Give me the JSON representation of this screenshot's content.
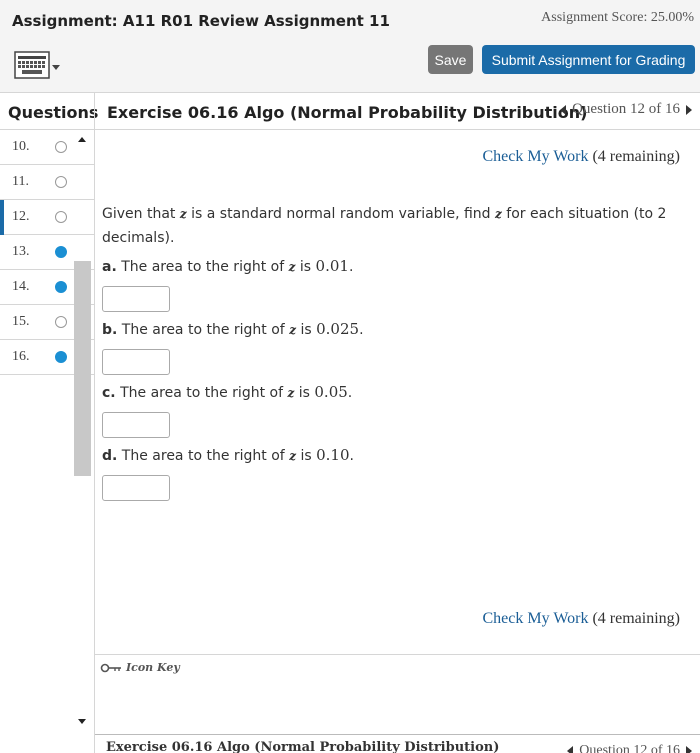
{
  "header": {
    "assignment_title": "Assignment: A11 R01 Review Assignment 11",
    "score": "Assignment Score: 25.00%",
    "save_label": "Save",
    "submit_label": "Submit Assignment for Grading"
  },
  "titlebar": {
    "questions_label": "Questions",
    "exercise_title": "Exercise 06.16 Algo (Normal Probability Distribution)",
    "question_nav": "Question 12 of 16"
  },
  "questions": [
    {
      "number": "10.",
      "status": "unanswered"
    },
    {
      "number": "11.",
      "status": "unanswered"
    },
    {
      "number": "12.",
      "status": "current"
    },
    {
      "number": "13.",
      "status": "answered"
    },
    {
      "number": "14.",
      "status": "answered"
    },
    {
      "number": "15.",
      "status": "unanswered"
    },
    {
      "number": "16.",
      "status": "answered"
    }
  ],
  "check": {
    "link_label": "Check My Work",
    "remaining": "(4 remaining)"
  },
  "problem": {
    "intro_a": "Given that ",
    "intro_b": " is a standard normal random variable, find ",
    "intro_c": " for each situation (to 2 decimals).",
    "z": "z",
    "parts": [
      {
        "letter": "a.",
        "text": "The area to the right of ",
        "mid": " is ",
        "value": "0.01",
        "end": "."
      },
      {
        "letter": "b.",
        "text": "The area to the right of ",
        "mid": " is ",
        "value": "0.025",
        "end": "."
      },
      {
        "letter": "c.",
        "text": "The area to the right of ",
        "mid": " is ",
        "value": "0.05",
        "end": "."
      },
      {
        "letter": "d.",
        "text": "The area to the right of ",
        "mid": " is ",
        "value": "0.10",
        "end": "."
      }
    ]
  },
  "icon_key_label": "Icon Key",
  "bottom": {
    "exercise_title": "Exercise 06.16 Algo (Normal Probability Distribution)",
    "question_nav": "Question 12 of 16"
  },
  "colors": {
    "accent": "#1b6ba8",
    "answered": "#1b8fd3",
    "save": "#767676"
  }
}
